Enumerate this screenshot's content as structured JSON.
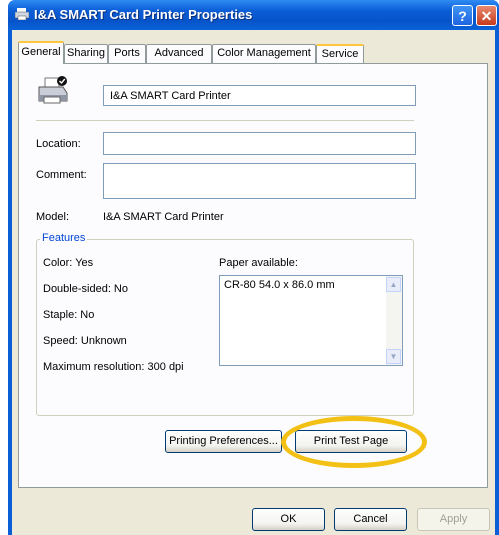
{
  "window": {
    "title": "I&A SMART Card Printer Properties",
    "help_glyph": "?",
    "close_glyph": "✕"
  },
  "tabs": [
    {
      "label": "General",
      "active": true
    },
    {
      "label": "Sharing"
    },
    {
      "label": "Ports"
    },
    {
      "label": "Advanced"
    },
    {
      "label": "Color Management"
    },
    {
      "label": "Service"
    }
  ],
  "general": {
    "printer_name": "I&A SMART Card Printer",
    "location_label": "Location:",
    "location_value": "",
    "comment_label": "Comment:",
    "comment_value": "",
    "model_label": "Model:",
    "model_value": "I&A SMART Card Printer"
  },
  "features": {
    "title": "Features",
    "color": "Color: Yes",
    "double_sided": "Double-sided: No",
    "staple": "Staple: No",
    "speed": "Speed: Unknown",
    "max_resolution": "Maximum resolution: 300 dpi",
    "paper_label": "Paper available:",
    "paper_items": [
      "CR-80 54.0 x 86.0 mm"
    ]
  },
  "buttons": {
    "printing_preferences": "Printing Preferences...",
    "print_test_page": "Print Test Page",
    "ok": "OK",
    "cancel": "Cancel",
    "apply": "Apply"
  },
  "colors": {
    "titlebar": "#0a5fd6",
    "dialog_bg": "#ece9d8",
    "highlight_ring": "#f3c116",
    "group_title": "#0046d5"
  }
}
